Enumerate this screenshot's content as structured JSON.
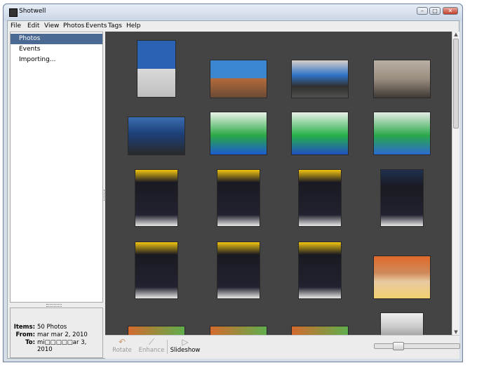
{
  "window": {
    "title": "Shotwell"
  },
  "menu": [
    "File",
    "Edit",
    "View",
    "Photos",
    "Events",
    "Tags",
    "Help"
  ],
  "sidebar": {
    "items": [
      {
        "label": "Photos",
        "selected": true
      },
      {
        "label": "Events",
        "selected": false
      },
      {
        "label": "Importing...",
        "selected": false
      }
    ]
  },
  "info": {
    "items_label": "Items:",
    "items_value": "50 Photos",
    "from_label": "From:",
    "from_value": "mar mar 2, 2010",
    "to_label": "To:",
    "to_value": "mi□□□□□ar 3, 2010"
  },
  "toolbar": {
    "rotate_label": "Rotate",
    "rotate_icon": "rotate-icon",
    "enhance_label": "Enhance",
    "enhance_icon": "enhance-icon",
    "slideshow_label": "Slideshow",
    "slideshow_icon": "play-icon",
    "zoom_level": 0.25
  },
  "colors": {
    "selection": "#4a6a94",
    "viewer_bg": "#444444"
  }
}
